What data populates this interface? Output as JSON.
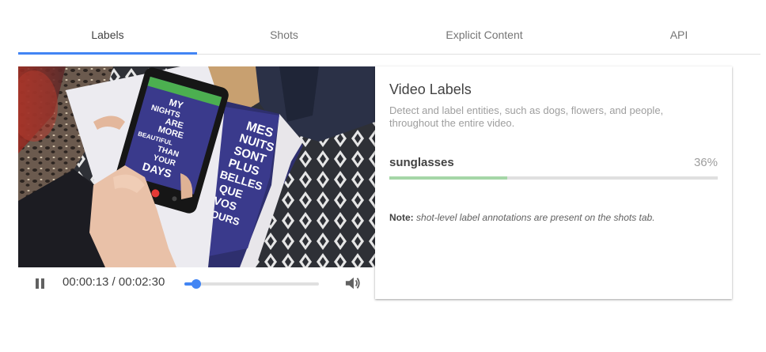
{
  "tabs": [
    {
      "label": "Labels",
      "active": true
    },
    {
      "label": "Shots",
      "active": false
    },
    {
      "label": "Explicit Content",
      "active": false
    },
    {
      "label": "API",
      "active": false
    }
  ],
  "colors": {
    "accent": "#4285f4",
    "label_bar": "#a5d6a7",
    "phone_bar": "#4caf50",
    "cover_purple": "#3a3a8c"
  },
  "player": {
    "time_display": "00:00:13 / 00:02:30",
    "progress_fraction": 0.087,
    "play_state_icon": "pause-icon",
    "volume_icon": "volume-icon"
  },
  "video_scene": {
    "phone_screen_text": [
      "MY",
      "NIGHTS",
      "ARE",
      "MORE",
      "BEAUTIFUL",
      "THAN",
      "YOUR",
      "DAYS"
    ],
    "book_cover_text": [
      "MES",
      "NUITS",
      "SONT",
      "PLUS",
      "BELLES",
      "QUE",
      "VOS",
      "JOURS"
    ]
  },
  "card": {
    "title": "Video Labels",
    "description": "Detect and label entities, such as dogs, flowers, and people, throughout the entire video.",
    "labels": [
      {
        "name": "sunglasses",
        "confidence_text": "36%",
        "confidence": 0.36
      }
    ],
    "note_prefix": "Note:",
    "note_text": "shot-level label annotations are present on the shots tab."
  }
}
